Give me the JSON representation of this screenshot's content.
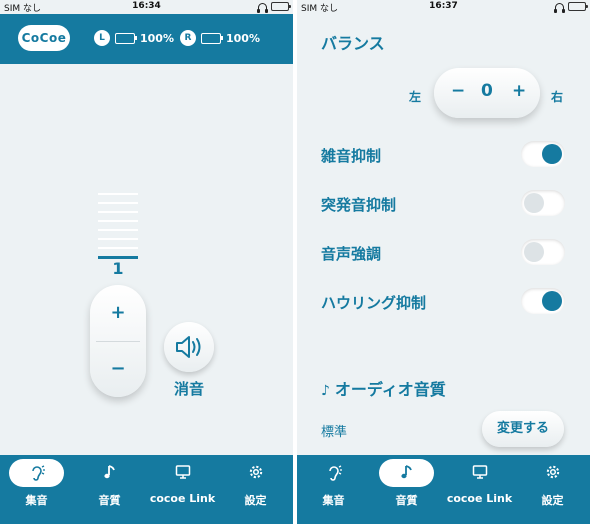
{
  "left_screen": {
    "status": {
      "carrier": "SIM なし",
      "time": "16:34"
    },
    "header": {
      "logo_text": "CoCoe",
      "left_earbud": {
        "side": "L",
        "battery": "100%"
      },
      "right_earbud": {
        "side": "R",
        "battery": "100%"
      }
    },
    "volume": {
      "level": "1",
      "plus": "+",
      "minus": "−",
      "meter_bars": 8,
      "active_bar": 8
    },
    "mute_label": "消音",
    "nav": [
      {
        "label": "集音",
        "icon": "ear-icon",
        "active": true
      },
      {
        "label": "音質",
        "icon": "music-note-icon",
        "active": false
      },
      {
        "label": "cocoe Link",
        "icon": "monitor-icon",
        "active": false
      },
      {
        "label": "設定",
        "icon": "gear-icon",
        "active": false
      }
    ]
  },
  "right_screen": {
    "status": {
      "carrier": "SIM なし",
      "time": "16:37"
    },
    "balance": {
      "title": "バランス",
      "left_label": "左",
      "right_label": "右",
      "minus": "−",
      "value": "0",
      "plus": "+"
    },
    "toggles": [
      {
        "label": "雑音抑制",
        "on": true
      },
      {
        "label": "突発音抑制",
        "on": false
      },
      {
        "label": "音声強調",
        "on": false
      },
      {
        "label": "ハウリング抑制",
        "on": true
      }
    ],
    "audio_quality": {
      "title": "オーディオ音質",
      "value": "標準",
      "change_button": "変更する"
    },
    "nav": [
      {
        "label": "集音",
        "icon": "ear-icon",
        "active": false
      },
      {
        "label": "音質",
        "icon": "music-note-icon",
        "active": true
      },
      {
        "label": "cocoe Link",
        "icon": "monitor-icon",
        "active": false
      },
      {
        "label": "設定",
        "icon": "gear-icon",
        "active": false
      }
    ]
  },
  "colors": {
    "accent": "#157aa0",
    "background": "#edf2f4",
    "battery_green": "#4cd964"
  }
}
